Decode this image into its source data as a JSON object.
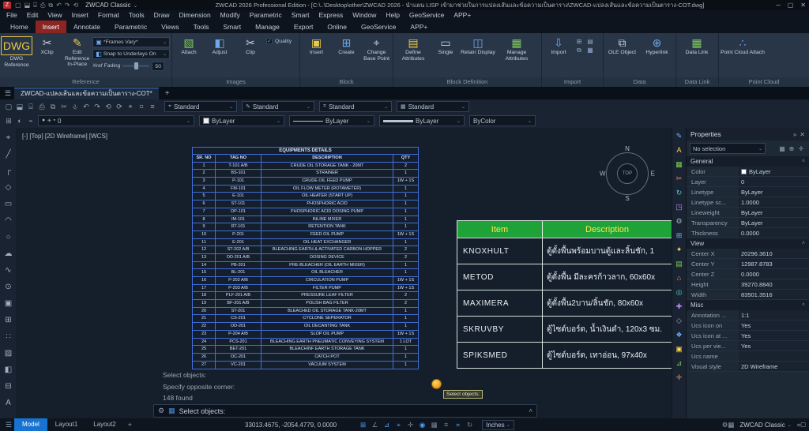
{
  "glyphs": {
    "caret": "⌄",
    "caret_up": "˄",
    "close": "✕",
    "minimize": "─",
    "maximize": "▢",
    "hamburger": "☰",
    "gear": "⚙",
    "check": "✓",
    "autohide": "»"
  },
  "icons": {
    "dwg": "DWG",
    "xclip": "✂",
    "edit_ref": "✎",
    "frames": "▣",
    "fading": "◧",
    "attach_img": "▧",
    "adjust": "◧",
    "clip": "✂",
    "insert": "▣",
    "create": "⊞",
    "base_point": "⌖",
    "define_attr": "▤",
    "single": "▭",
    "retain": "◫",
    "manage_attr": "▦",
    "import": "⇩",
    "ole": "⧉",
    "hyperlink": "⊕",
    "datalink": "▦",
    "pointcloud": "∴",
    "cmd": "▦"
  },
  "titlebar": {
    "workspace": "ZWCAD Classic",
    "logo": "Z",
    "title": "ZWCAD 2026 Professional Edition - [C:\\..\\Desktop\\other\\ZWCAD 2026 - นำแผน LISP เข้ามาช่วยในการแปลงเส้นและข้อความเป็นตาราง\\ZWCAD-แปลงเส้นและข้อความเป็นตาราง-COT.dwg]",
    "qat_icons": [
      "▢",
      "⬓",
      "⌸",
      "⎙",
      "⧉",
      "↶",
      "↷",
      "⟲"
    ]
  },
  "menus": [
    "File",
    "Edit",
    "View",
    "Insert",
    "Format",
    "Tools",
    "Draw",
    "Dimension",
    "Modify",
    "Parametric",
    "Smart",
    "Express",
    "Window",
    "Help",
    "GeoService",
    "APP+"
  ],
  "ribbon_tabs": [
    {
      "label": "Home"
    },
    {
      "label": "Insert",
      "on": true
    },
    {
      "label": "Annotate"
    },
    {
      "label": "Parametric"
    },
    {
      "label": "Views"
    },
    {
      "label": "Tools"
    },
    {
      "label": "Smart"
    },
    {
      "label": "Manage"
    },
    {
      "label": "Export"
    },
    {
      "label": "Online"
    },
    {
      "label": "GeoService"
    },
    {
      "label": "APP+"
    }
  ],
  "ribbon": {
    "reference": {
      "caption": "Reference",
      "dwg_reference": "DWG Reference",
      "xclip": "XClip",
      "edit_reference": "Edit Reference In-Place",
      "frames_vary": "*Frames Vary*",
      "snap_underlays": "Snap to Underlays On",
      "xref_fading": "Xref Fading",
      "xref_fading_value": "50"
    },
    "images": {
      "caption": "Images",
      "attach": "Attach",
      "adjust": "Adjust",
      "clip": "Clip",
      "quality": "Quality"
    },
    "block": {
      "caption": "Block",
      "insert": "Insert",
      "create": "Create",
      "change_base_point": "Change Base Point"
    },
    "block_definition": {
      "caption": "Block Definition",
      "define_attributes": "Define Attributes",
      "single": "Single",
      "retain_display": "Retain Display",
      "manage_attributes": "Manage Attributes"
    },
    "import": {
      "caption": "Import",
      "import_btn": "Import",
      "mini_icons": [
        "⊞",
        "▤",
        "⧉",
        "▦"
      ]
    },
    "data": {
      "caption": "Data",
      "ole_object": "OLE Object",
      "hyperlink": "Hyperlink"
    },
    "data_link": {
      "caption": "Data Link",
      "data_link": "Data Link"
    },
    "point_cloud": {
      "caption": "Point Cloud",
      "attach": "Point Cloud Attach"
    }
  },
  "doc_tab": {
    "label": "ZWCAD-แปลงเส้นและข้อความเป็นตาราง-COT*",
    "add": "+"
  },
  "toolbar1": {
    "icons": [
      "▢",
      "⬓",
      "⌸",
      "⎙",
      "⧉",
      "✂",
      "⎀",
      "↶",
      "↷",
      "⟲",
      "⟳",
      "⌖",
      "⌗",
      "≡"
    ],
    "combos": [
      {
        "icon": "⌖",
        "value": "Standard"
      },
      {
        "icon": "✎",
        "value": "Standard"
      },
      {
        "icon": "⌗",
        "value": "Standard"
      },
      {
        "icon": "▦",
        "value": "Standard"
      }
    ]
  },
  "toolbar2": {
    "icons": [
      "⊞",
      "◐",
      "⌁"
    ],
    "layer_glyphs": [
      "●",
      "☀",
      "▪"
    ],
    "layer_value": "0",
    "color_value": "ByLayer",
    "linetype_value": "ByLayer",
    "lineweight_value": "ByLayer",
    "plotstyle_value": "ByColor"
  },
  "left_tools": [
    "⌖",
    "╱",
    "┌",
    "◇",
    "▭",
    "◠",
    "○",
    "☁",
    "∿",
    "⊙",
    "▣",
    "⊞",
    "∷",
    "▨",
    "◧",
    "⊟",
    "A"
  ],
  "right_tools": [
    {
      "g": "✎",
      "c": "#6fb3ff"
    },
    {
      "g": "A",
      "c": "#ffd24a"
    },
    {
      "g": "▦",
      "c": "#7fd14a"
    },
    {
      "g": "✂",
      "c": "#ff8a5e"
    },
    {
      "g": "↻",
      "c": "#4ad1c8"
    },
    {
      "g": "◳",
      "c": "#c08aff"
    },
    {
      "g": "⚙",
      "c": "#9fb0c0"
    },
    {
      "g": "⊞",
      "c": "#6fb3ff"
    },
    {
      "g": "✦",
      "c": "#ffd24a"
    },
    {
      "g": "▤",
      "c": "#7fd14a"
    },
    {
      "g": "⌂",
      "c": "#ff8a5e"
    },
    {
      "g": "◎",
      "c": "#4ad1c8"
    },
    {
      "g": "✚",
      "c": "#c08aff"
    },
    {
      "g": "◇",
      "c": "#9fb0c0"
    },
    {
      "g": "❖",
      "c": "#6fb3ff"
    },
    {
      "g": "▣",
      "c": "#ffd24a"
    },
    {
      "g": "⊿",
      "c": "#7fd14a"
    },
    {
      "g": "✛",
      "c": "#ff8a5e"
    }
  ],
  "canvas": {
    "viewport_label": "[-] [Top] [2D Wireframe] [WCS]",
    "compass": {
      "n": "N",
      "e": "E",
      "s": "S",
      "w": "W",
      "center": "TOP"
    }
  },
  "equipment_table": {
    "title": "EQUIPMENTS DETAILS",
    "headers": [
      "SR. NO",
      "TAG NO",
      "DESCRIPTION",
      "QTY"
    ],
    "rows": [
      {
        "sr": "1",
        "tag": "T-101 A/B",
        "desc": "CRUDE OIL STORAGE TANK - 20MT",
        "qty": "2"
      },
      {
        "sr": "2",
        "tag": "BS-101",
        "desc": "STRAINER",
        "qty": "1"
      },
      {
        "sr": "3",
        "tag": "P-101",
        "desc": "CRUDE OIL FEED PUMP",
        "qty": "1W + 1S"
      },
      {
        "sr": "4",
        "tag": "FM-101",
        "desc": "OIL FLOW METER (ROTAMETER)",
        "qty": "1"
      },
      {
        "sr": "5",
        "tag": "E-101",
        "desc": "OIL HEATER (START UP)",
        "qty": "1"
      },
      {
        "sr": "6",
        "tag": "ST-101",
        "desc": "PHOSPHORIC ACID",
        "qty": "1"
      },
      {
        "sr": "7",
        "tag": "DP-101",
        "desc": "PHOSPHORIC ACID DOSING PUMP",
        "qty": "1"
      },
      {
        "sr": "8",
        "tag": "IM-101",
        "desc": "INLINE MIXER",
        "qty": "1"
      },
      {
        "sr": "9",
        "tag": "RT-101",
        "desc": "RETENTION TANK",
        "qty": "1"
      },
      {
        "sr": "10",
        "tag": "P-201",
        "desc": "FEED OIL PUMP",
        "qty": "1W + 1S"
      },
      {
        "sr": "11",
        "tag": "E-201",
        "desc": "OIL HEAT EXCHANGER",
        "qty": "1"
      },
      {
        "sr": "12",
        "tag": "ST-202 A/B",
        "desc": "BLEACHING EARTH & ACTIVATED CARBON HOPPER",
        "qty": "2"
      },
      {
        "sr": "13",
        "tag": "DD-201 A/B",
        "desc": "DOSING DEVICE",
        "qty": "2"
      },
      {
        "sr": "14",
        "tag": "PB-201",
        "desc": "PRE-BLEACHER (OIL EARTH MIXER)",
        "qty": "1"
      },
      {
        "sr": "15",
        "tag": "BL-201",
        "desc": "OIL BLEACHER",
        "qty": "1"
      },
      {
        "sr": "16",
        "tag": "P-202 A/B",
        "desc": "CIRCULATION PUMP",
        "qty": "1W + 1S"
      },
      {
        "sr": "17",
        "tag": "P-203 A/B",
        "desc": "FILTER PUMP",
        "qty": "1W + 1S"
      },
      {
        "sr": "18",
        "tag": "PLF-201 A/B",
        "desc": "PRESSURE LEAF FILTER",
        "qty": "2"
      },
      {
        "sr": "19",
        "tag": "BF-201 A/B",
        "desc": "POLISH BAG FILTER",
        "qty": "2"
      },
      {
        "sr": "20",
        "tag": "ST-201",
        "desc": "BLEACHED OIL STORAGE TANK-20MT",
        "qty": "1"
      },
      {
        "sr": "21",
        "tag": "CS-201",
        "desc": "CYCLONE SEPERATOR",
        "qty": "1"
      },
      {
        "sr": "22",
        "tag": "OD-201",
        "desc": "OIL DECANTING TANK",
        "qty": "1"
      },
      {
        "sr": "23",
        "tag": "P-204 A/B",
        "desc": "SLOP OIL PUMP",
        "qty": "1W + 1S"
      },
      {
        "sr": "24",
        "tag": "PCS-201",
        "desc": "BLEACHING EARTH PNEUMATIC CONVEYING SYSTEM",
        "qty": "1 LOT"
      },
      {
        "sr": "25",
        "tag": "BET-201",
        "desc": "BLEACHINF EARTH STORAGE TANK",
        "qty": "1"
      },
      {
        "sr": "26",
        "tag": "OC-201",
        "desc": "CATCH POT",
        "qty": "1"
      },
      {
        "sr": "27",
        "tag": "VC-201",
        "desc": "VACUUM SYSTEM",
        "qty": "1"
      }
    ]
  },
  "ikea_table": {
    "header_item": "Item",
    "header_desc": "Description",
    "header_bg": "#1fa238",
    "header_text_color": "#ffe84a",
    "rows": [
      {
        "item": "KNOXHULT",
        "desc": "ตู้ตั้งพื้นพร้อมบานตู้และลิ้นชัก, 1"
      },
      {
        "item": "METOD",
        "desc": "ตู้ตั้งพื้น มีละครก้าวลาก, 60x60x"
      },
      {
        "item": "MAXIMERA",
        "desc": "ตู้ตั้งพื้น2บาน/ลิ้นชัก, 80x60x"
      },
      {
        "item": "SKRUVBY",
        "desc": "ตู้ไซด์บอร์ด, น้ำเงินดำ, 120x3 ซม."
      },
      {
        "item": "SPIKSMED",
        "desc": "ตู้ไซด์บอร์ด, เทาอ่อน, 97x40x"
      }
    ]
  },
  "command": {
    "history": [
      "Select objects:",
      "Specify opposite corner:",
      "148 found"
    ],
    "prompt": "Select objects:",
    "tooltip": "Select objects:"
  },
  "properties": {
    "title": "Properties",
    "selection": "No selection",
    "sel_icons": [
      "▦",
      "⊕",
      "✛"
    ],
    "general_label": "General",
    "general_rows": [
      {
        "label": "Color",
        "value": "ByLayer",
        "swatch": "#ffffff"
      },
      {
        "label": "Layer",
        "value": "0"
      },
      {
        "label": "Linetype",
        "value": "ByLayer"
      },
      {
        "label": "Linetype sc...",
        "value": "1.0000"
      },
      {
        "label": "Lineweight",
        "value": "ByLayer"
      },
      {
        "label": "Transparency",
        "value": "ByLayer"
      },
      {
        "label": "Thickness",
        "value": "0.0000"
      }
    ],
    "view_label": "View",
    "view_rows": [
      {
        "label": "Center X",
        "value": "20296.3610"
      },
      {
        "label": "Center Y",
        "value": "12987.8783"
      },
      {
        "label": "Center Z",
        "value": "0.0000"
      },
      {
        "label": "Height",
        "value": "39270.8840"
      },
      {
        "label": "Width",
        "value": "83501.3516"
      }
    ],
    "misc_label": "Misc",
    "misc_rows": [
      {
        "label": "Annotation ...",
        "value": "1:1"
      },
      {
        "label": "Ucs icon on",
        "value": "Yes"
      },
      {
        "label": "Ucs icon at ...",
        "value": "Yes"
      },
      {
        "label": "Ucs per vie...",
        "value": "Yes"
      },
      {
        "label": "Ucs name",
        "value": ""
      },
      {
        "label": "Visual style",
        "value": "2D Wireframe"
      }
    ]
  },
  "statusbar": {
    "tabs": [
      {
        "label": "Model",
        "on": true
      },
      {
        "label": "Layout1"
      },
      {
        "label": "Layout2"
      }
    ],
    "add": "+",
    "coords": "33013.4675, -2054.4779, 0.0000",
    "toggles": [
      {
        "g": "⊞",
        "on": true
      },
      {
        "g": "∠"
      },
      {
        "g": "⊿",
        "on": true
      },
      {
        "g": "⌖",
        "on": true
      },
      {
        "g": "✛"
      },
      {
        "g": "◉",
        "on": true
      },
      {
        "g": "▦"
      },
      {
        "g": "≡"
      },
      {
        "g": "⌗",
        "on": true
      },
      {
        "g": "↻"
      }
    ],
    "units": "Inches",
    "mid_icons": [
      "⚙",
      "▦"
    ],
    "workspace": "ZWCAD Classic",
    "end_icons": [
      "⌗",
      "▢"
    ]
  }
}
